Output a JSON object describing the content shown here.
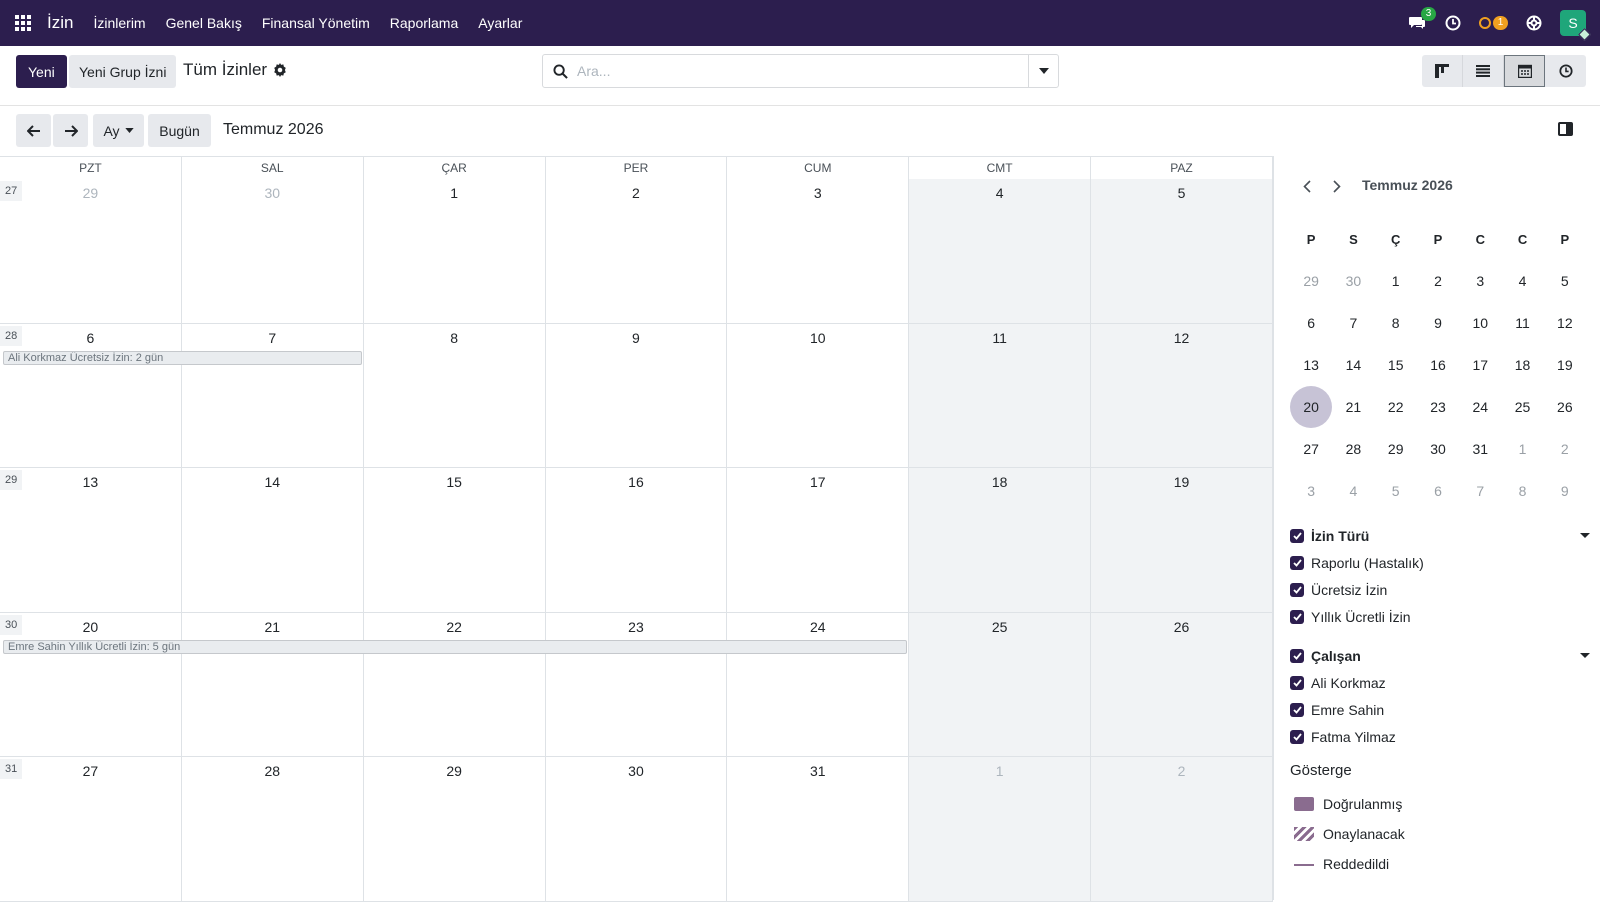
{
  "navbar": {
    "app_name": "İzin",
    "menu": [
      "İzinlerim",
      "Genel Bakış",
      "Finansal Yönetim",
      "Raporlama",
      "Ayarlar"
    ],
    "messages_badge": "3",
    "activity_badge": "1",
    "avatar_letter": "S",
    "bg_color": "#2c1e4e"
  },
  "control": {
    "new_button": "Yeni",
    "new_group_button": "Yeni Grup İzni",
    "title": "Tüm İzinler",
    "search_placeholder": "Ara...",
    "views": [
      "kanban",
      "list",
      "calendar",
      "activity"
    ],
    "active_view": "calendar"
  },
  "toolbar": {
    "scale_label": "Ay",
    "today_label": "Bugün",
    "period_title": "Temmuz 2026"
  },
  "calendar": {
    "days_of_week": [
      "PZT",
      "SAL",
      "ÇAR",
      "PER",
      "CUM",
      "CMT",
      "PAZ"
    ],
    "weeks": [
      {
        "no": "27",
        "days": [
          {
            "d": "29",
            "o": true
          },
          {
            "d": "30",
            "o": true
          },
          {
            "d": "1"
          },
          {
            "d": "2"
          },
          {
            "d": "3"
          },
          {
            "d": "4"
          },
          {
            "d": "5"
          }
        ]
      },
      {
        "no": "28",
        "days": [
          {
            "d": "6"
          },
          {
            "d": "7"
          },
          {
            "d": "8"
          },
          {
            "d": "9"
          },
          {
            "d": "10"
          },
          {
            "d": "11"
          },
          {
            "d": "12"
          }
        ]
      },
      {
        "no": "29",
        "days": [
          {
            "d": "13"
          },
          {
            "d": "14"
          },
          {
            "d": "15"
          },
          {
            "d": "16"
          },
          {
            "d": "17"
          },
          {
            "d": "18"
          },
          {
            "d": "19"
          }
        ]
      },
      {
        "no": "30",
        "days": [
          {
            "d": "20"
          },
          {
            "d": "21"
          },
          {
            "d": "22"
          },
          {
            "d": "23"
          },
          {
            "d": "24"
          },
          {
            "d": "25"
          },
          {
            "d": "26"
          }
        ]
      },
      {
        "no": "31",
        "days": [
          {
            "d": "27"
          },
          {
            "d": "28"
          },
          {
            "d": "29"
          },
          {
            "d": "30"
          },
          {
            "d": "31"
          },
          {
            "d": "1",
            "o": true
          },
          {
            "d": "2",
            "o": true
          }
        ]
      }
    ],
    "events": [
      {
        "label": "Ali Korkmaz Ücretsiz İzin: 2 gün",
        "week": 1,
        "start_day": 0,
        "span": 2
      },
      {
        "label": "Emre Sahin Yıllık Ücretli İzin: 5 gün",
        "week": 3,
        "start_day": 0,
        "span": 5
      }
    ]
  },
  "mini_calendar": {
    "title": "Temmuz 2026",
    "headers": [
      "P",
      "S",
      "Ç",
      "P",
      "C",
      "C",
      "P"
    ],
    "today": "20",
    "rows": [
      [
        {
          "d": "29",
          "o": true
        },
        {
          "d": "30",
          "o": true
        },
        {
          "d": "1"
        },
        {
          "d": "2"
        },
        {
          "d": "3"
        },
        {
          "d": "4"
        },
        {
          "d": "5"
        }
      ],
      [
        {
          "d": "6"
        },
        {
          "d": "7"
        },
        {
          "d": "8"
        },
        {
          "d": "9"
        },
        {
          "d": "10"
        },
        {
          "d": "11"
        },
        {
          "d": "12"
        }
      ],
      [
        {
          "d": "13"
        },
        {
          "d": "14"
        },
        {
          "d": "15"
        },
        {
          "d": "16"
        },
        {
          "d": "17"
        },
        {
          "d": "18"
        },
        {
          "d": "19"
        }
      ],
      [
        {
          "d": "20"
        },
        {
          "d": "21"
        },
        {
          "d": "22"
        },
        {
          "d": "23"
        },
        {
          "d": "24"
        },
        {
          "d": "25"
        },
        {
          "d": "26"
        }
      ],
      [
        {
          "d": "27"
        },
        {
          "d": "28"
        },
        {
          "d": "29"
        },
        {
          "d": "30"
        },
        {
          "d": "31"
        },
        {
          "d": "1",
          "o": true
        },
        {
          "d": "2",
          "o": true
        }
      ],
      [
        {
          "d": "3",
          "o": true
        },
        {
          "d": "4",
          "o": true
        },
        {
          "d": "5",
          "o": true
        },
        {
          "d": "6",
          "o": true
        },
        {
          "d": "7",
          "o": true
        },
        {
          "d": "8",
          "o": true
        },
        {
          "d": "9",
          "o": true
        }
      ]
    ]
  },
  "filters": {
    "leave_type": {
      "title": "İzin Türü",
      "items": [
        "Raporlu (Hastalık)",
        "Ücretsiz İzin",
        "Yıllık Ücretli İzin"
      ]
    },
    "employee": {
      "title": "Çalışan",
      "items": [
        "Ali Korkmaz",
        "Emre Sahin",
        "Fatma Yilmaz"
      ]
    }
  },
  "legend": {
    "title": "Gösterge",
    "items": [
      "Doğrulanmış",
      "Onaylanacak",
      "Reddedildi"
    ],
    "color": "#8a6c8f"
  }
}
